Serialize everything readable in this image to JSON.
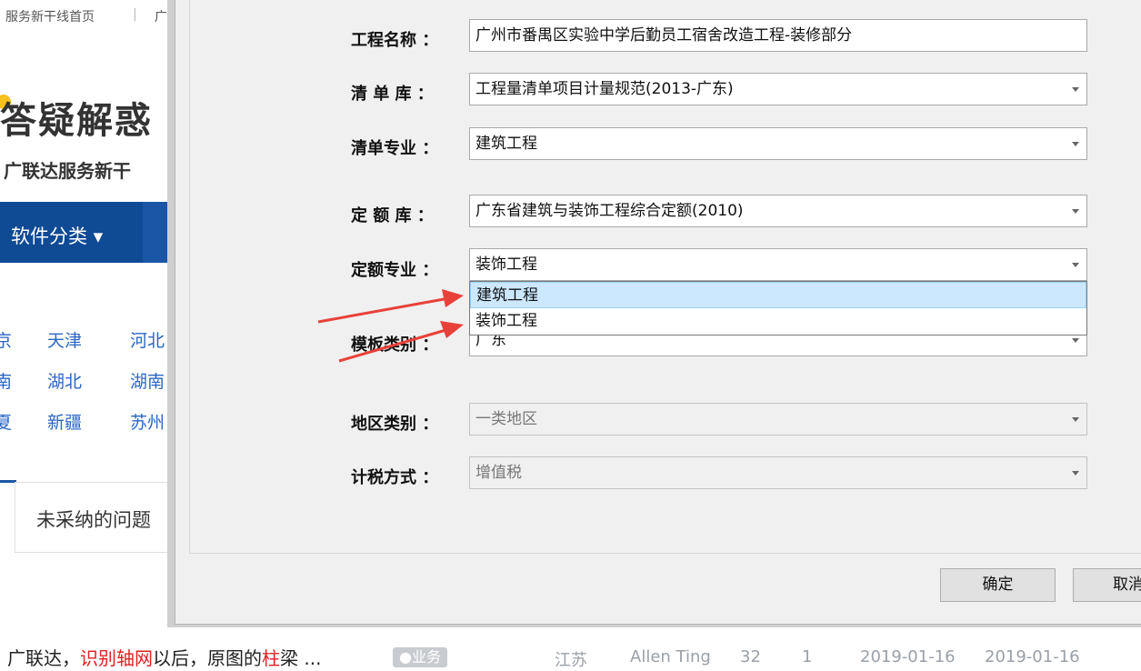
{
  "background": {
    "topbar": [
      "服务新干线首页",
      "|",
      "广"
    ],
    "logo_text": "答疑解惑",
    "subtitle": "广联达服务新干",
    "nav": {
      "software_category": "软件分类 ▾"
    },
    "cities": [
      [
        "京",
        "天津",
        "河北"
      ],
      [
        "南",
        "湖北",
        "湖南"
      ],
      [
        "夏",
        "新疆",
        "苏州"
      ]
    ],
    "tab_label": "未采纳的问题",
    "row": {
      "title_prefix": "广联达，",
      "title_red1": "识别轴网",
      "title_mid": "以后，原图的",
      "title_red2": "柱",
      "title_suffix": "梁 ...",
      "tag": "●业务",
      "region": "江苏",
      "author": "Allen Ting",
      "answers": "32",
      "views": "1",
      "date_created": "2019-01-16",
      "date_updated": "2019-01-16"
    }
  },
  "dialog": {
    "fields": [
      {
        "label": "工程名称 ：",
        "value": "广州市番禺区实验中学后勤员工宿舍改造工程-装修部分",
        "type": "text"
      },
      {
        "label": "清 单 库 ：",
        "value": "工程量清单项目计量规范(2013-广东)",
        "type": "select"
      },
      {
        "label": "清单专业 ：",
        "value": "建筑工程",
        "type": "select"
      },
      {
        "label": "定 额 库 ：",
        "value": "广东省建筑与装饰工程综合定额(2010)",
        "type": "select"
      },
      {
        "label": "定额专业 ：",
        "value": "装饰工程",
        "type": "select"
      },
      {
        "label": "模板类别 ：",
        "value": "广东",
        "type": "select"
      },
      {
        "label": "地区类别 ：",
        "value": "一类地区",
        "type": "select-disabled"
      },
      {
        "label": "计税方式 ：",
        "value": "增值税",
        "type": "select-disabled"
      }
    ],
    "quota_major_options": [
      "建筑工程",
      "装饰工程"
    ],
    "ok_button": "确定",
    "cancel_button": "取消",
    "annotation_color": "#e8413a"
  }
}
